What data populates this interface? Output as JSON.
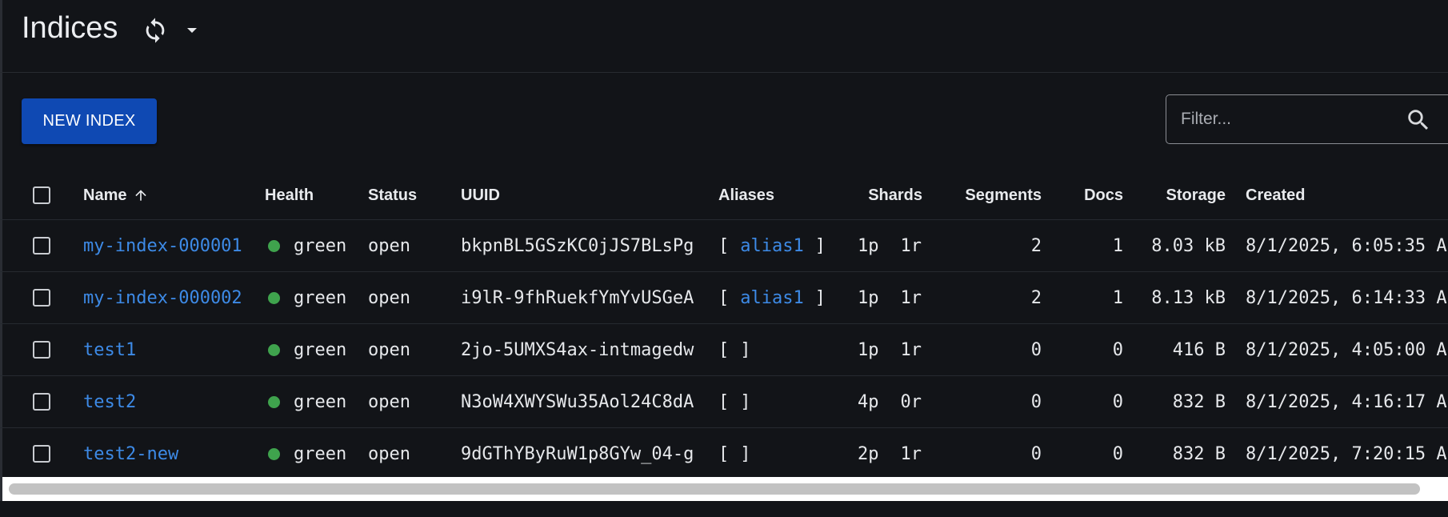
{
  "header": {
    "title": "Indices"
  },
  "toolbar": {
    "new_index_label": "NEW INDEX",
    "filter_placeholder": "Filter...",
    "filter_value": ""
  },
  "table": {
    "columns": {
      "name": "Name",
      "health": "Health",
      "status": "Status",
      "uuid": "UUID",
      "aliases": "Aliases",
      "shards": "Shards",
      "segments": "Segments",
      "docs": "Docs",
      "storage": "Storage",
      "created": "Created"
    },
    "sort": {
      "column": "name",
      "direction": "ascending"
    },
    "rows": [
      {
        "name": "my-index-000001",
        "health": "green",
        "status": "open",
        "uuid": "bkpnBL5GSzKC0jJS7BLsPg",
        "alias_open": "[",
        "alias": "alias1",
        "alias_close": "]",
        "primary_shards": "1p",
        "replica_shards": "1r",
        "segments": "2",
        "docs": "1",
        "storage": "8.03 kB",
        "created": "8/1/2025, 6:05:35 A"
      },
      {
        "name": "my-index-000002",
        "health": "green",
        "status": "open",
        "uuid": "i9lR-9fhRuekfYmYvUSGeA",
        "alias_open": "[",
        "alias": "alias1",
        "alias_close": "]",
        "primary_shards": "1p",
        "replica_shards": "1r",
        "segments": "2",
        "docs": "1",
        "storage": "8.13 kB",
        "created": "8/1/2025, 6:14:33 A"
      },
      {
        "name": "test1",
        "health": "green",
        "status": "open",
        "uuid": "2jo-5UMXS4ax-intmagedw",
        "alias_open": "[",
        "alias": "",
        "alias_close": "]",
        "primary_shards": "1p",
        "replica_shards": "1r",
        "segments": "0",
        "docs": "0",
        "storage": "416 B",
        "created": "8/1/2025, 4:05:00 A"
      },
      {
        "name": "test2",
        "health": "green",
        "status": "open",
        "uuid": "N3oW4XWYSWu35Aol24C8dA",
        "alias_open": "[",
        "alias": "",
        "alias_close": "]",
        "primary_shards": "4p",
        "replica_shards": "0r",
        "segments": "0",
        "docs": "0",
        "storage": "832 B",
        "created": "8/1/2025, 4:16:17 A"
      },
      {
        "name": "test2-new",
        "health": "green",
        "status": "open",
        "uuid": "9dGThYByRuW1p8GYw_04-g",
        "alias_open": "[",
        "alias": "",
        "alias_close": "]",
        "primary_shards": "2p",
        "replica_shards": "1r",
        "segments": "0",
        "docs": "0",
        "storage": "832 B",
        "created": "8/1/2025, 7:20:15 A"
      }
    ]
  },
  "icons": {
    "refresh": "refresh-icon",
    "dropdown": "caret-down-icon",
    "search": "search-icon",
    "sort": "arrow-up-icon"
  },
  "colors": {
    "background": "#121418",
    "primary_button": "#0f49b3",
    "link": "#3d8ae6",
    "health_green": "#3fa34d"
  }
}
